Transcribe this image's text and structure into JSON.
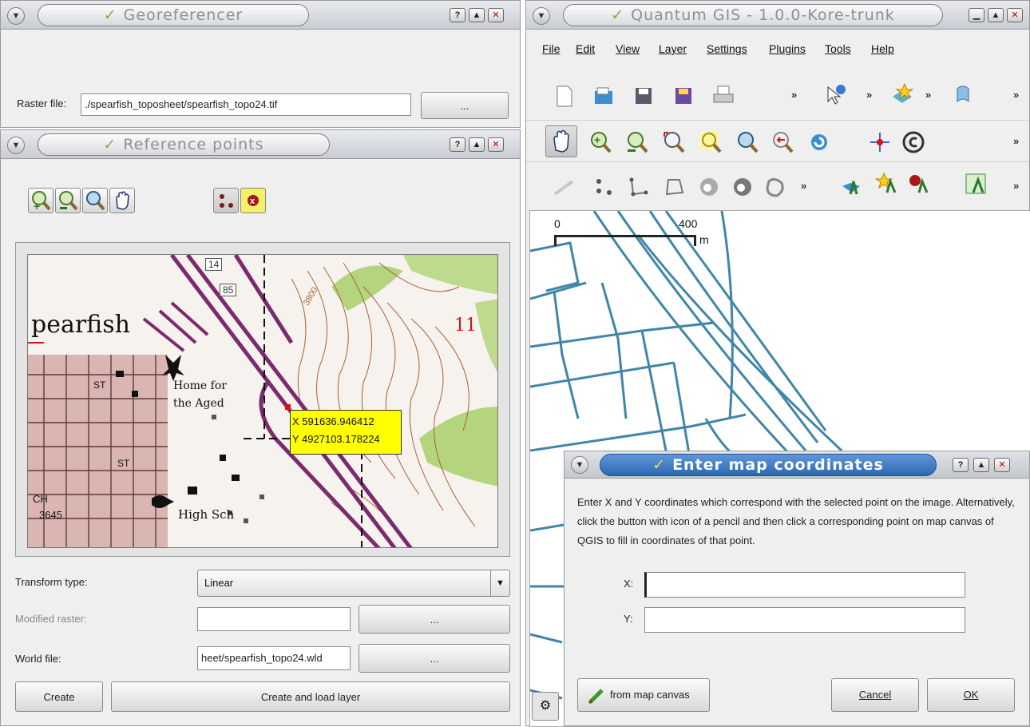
{
  "georeferencer": {
    "title": "Georeferencer",
    "raster_label": "Raster file:",
    "raster_value": "./spearfish_toposheet/spearfish_topo24.tif",
    "browse_label": "..."
  },
  "reference_points": {
    "title": "Reference points",
    "map_labels": {
      "town": "pearfish",
      "home_line1": "Home for",
      "home_line2": "the Aged",
      "school": "High Sch",
      "section": "11",
      "st1": "ST",
      "st2": "ST",
      "road1": "14",
      "road2": "85",
      "contour": "3800",
      "ch": "CH",
      "num": "3645"
    },
    "tooltip": {
      "x": "X 591636.946412",
      "y": "Y 4927103.178224"
    },
    "transform_label": "Transform type:",
    "transform_value": "Linear",
    "modified_label": "Modified raster:",
    "world_label": "World file:",
    "world_value": "heet/spearfish_topo24.wld",
    "browse_label": "...",
    "create_label": "Create",
    "create_load_label": "Create and load layer"
  },
  "qgis": {
    "title": "Quantum GIS - 1.0.0-Kore-trunk",
    "menu": [
      "File",
      "Edit",
      "View",
      "Layer",
      "Settings",
      "Plugins",
      "Tools",
      "Help"
    ],
    "more": "»",
    "scale": {
      "start": "0",
      "end": "400",
      "unit": "m"
    }
  },
  "dialog": {
    "title": "Enter map coordinates",
    "instructions": "Enter X and Y coordinates which correspond with the selected point on the image. Alternatively, click the button with icon of a pencil and then click a corresponding point on map canvas of QGIS to fill in coordinates of that point.",
    "x_label": "X:",
    "y_label": "Y:",
    "x_value": "",
    "y_value": "",
    "from_canvas_label": "from map canvas",
    "cancel_label": "Cancel",
    "ok_label": "OK"
  },
  "colors": {
    "title_text": "#8f8f8f",
    "tooltip_bg": "#ffff00",
    "road": "#3f86a8",
    "topo_road": "#7b2a6e"
  }
}
